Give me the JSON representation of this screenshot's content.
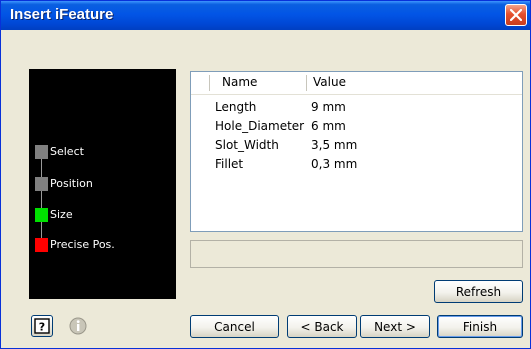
{
  "window": {
    "title": "Insert iFeature"
  },
  "steps": [
    {
      "label": "Select",
      "color": "#808080"
    },
    {
      "label": "Position",
      "color": "#808080"
    },
    {
      "label": "Size",
      "color": "#00e000"
    },
    {
      "label": "Precise Pos.",
      "color": "#ff0000"
    }
  ],
  "table": {
    "headers": {
      "name": "Name",
      "value": "Value"
    },
    "rows": [
      {
        "name": "Length",
        "value": "9 mm"
      },
      {
        "name": "Hole_Diameter",
        "value": "6 mm"
      },
      {
        "name": "Slot_Width",
        "value": "3,5 mm"
      },
      {
        "name": "Fillet",
        "value": "0,3 mm"
      }
    ]
  },
  "buttons": {
    "refresh": "Refresh",
    "cancel": "Cancel",
    "back": "< Back",
    "next": "Next >",
    "finish": "Finish"
  },
  "icons": {
    "help": "help-icon",
    "info": "info-icon",
    "close": "close-icon"
  },
  "colors": {
    "titlebar": "#0255e6",
    "panel_bg": "#ece9d8"
  }
}
